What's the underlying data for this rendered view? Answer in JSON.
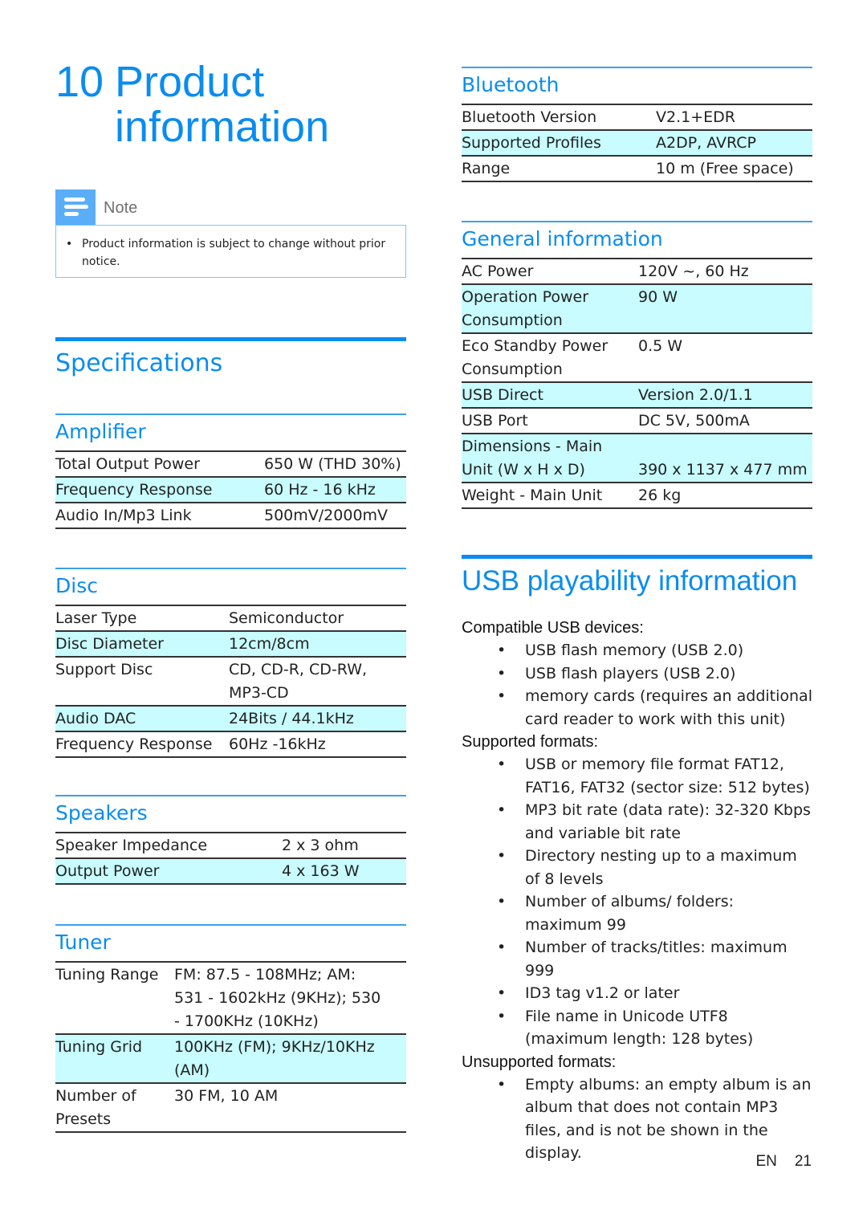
{
  "chapter": {
    "number": "10",
    "title_line1": "Product",
    "title_line2": "information"
  },
  "note": {
    "icon": "note-icon",
    "label": "Note",
    "items": [
      "Product information is subject to change without prior notice."
    ]
  },
  "specifications": {
    "title": "Specifications"
  },
  "amplifier": {
    "title": "Amplifier",
    "rows": [
      {
        "label": "Total Output Power",
        "value": "650 W  (THD 30%)"
      },
      {
        "label": "Frequency Response",
        "value": "60 Hz - 16 kHz"
      },
      {
        "label": "Audio In/Mp3 Link",
        "value": "500mV/2000mV"
      }
    ]
  },
  "disc": {
    "title": "Disc",
    "rows": [
      {
        "label": "Laser Type",
        "value": "Semiconductor"
      },
      {
        "label": "Disc Diameter",
        "value": "12cm/8cm"
      },
      {
        "label": "Support Disc",
        "value": "CD, CD-R, CD-RW, MP3-CD"
      },
      {
        "label": "Audio DAC",
        "value": "24Bits / 44.1kHz"
      },
      {
        "label": "Frequency Response",
        "value": "60Hz -16kHz"
      }
    ]
  },
  "speakers": {
    "title": "Speakers",
    "rows": [
      {
        "label": "Speaker Impedance",
        "value": "2 x 3 ohm"
      },
      {
        "label": "Output Power",
        "value": "4 x 163 W"
      }
    ]
  },
  "tuner": {
    "title": "Tuner",
    "rows": [
      {
        "label": "Tuning Range",
        "value": "FM: 87.5 - 108MHz; AM: 531 - 1602kHz (9KHz); 530 - 1700KHz (10KHz)"
      },
      {
        "label": "Tuning Grid",
        "value": "100KHz (FM); 9KHz/10KHz (AM)"
      },
      {
        "label": "Number of Presets",
        "value": "30 FM, 10 AM"
      }
    ]
  },
  "bluetooth": {
    "title": "Bluetooth",
    "rows": [
      {
        "label": "Bluetooth Version",
        "value": "V2.1+EDR"
      },
      {
        "label": "Supported Profiles",
        "value": "A2DP, AVRCP"
      },
      {
        "label": "Range",
        "value": "10 m (Free space)"
      }
    ]
  },
  "general": {
    "title": "General information",
    "rows": [
      {
        "label": "AC Power",
        "value": "120V ~, 60 Hz"
      },
      {
        "label": "Operation Power Consumption",
        "value": "90 W"
      },
      {
        "label": "Eco Standby Power Consumption",
        "value": "0.5 W"
      },
      {
        "label": "USB Direct",
        "value": "Version 2.0/1.1"
      },
      {
        "label": "USB Port",
        "value": "DC 5V, 500mA"
      },
      {
        "label": "Dimensions - Main Unit (W x H x D)",
        "value": "390 x 1137 x 477 mm"
      },
      {
        "label": "Weight - Main Unit",
        "value": "26 kg"
      }
    ]
  },
  "usb": {
    "title": "USB playability information",
    "compatible": {
      "heading": "Compatible USB devices:",
      "items": [
        "USB flash memory (USB 2.0)",
        "USB flash players (USB 2.0)",
        "memory cards (requires an additional card reader to work with this unit)"
      ]
    },
    "supported": {
      "heading": "Supported formats:",
      "items": [
        "USB or memory file format FAT12, FAT16, FAT32 (sector size: 512 bytes)",
        "MP3 bit rate (data rate): 32-320 Kbps and variable bit rate",
        "Directory nesting up to a maximum of 8 levels",
        "Number of albums/ folders: maximum 99",
        "Number of tracks/titles: maximum 999",
        "ID3 tag v1.2 or later",
        "File name in Unicode UTF8 (maximum length: 128 bytes)"
      ]
    },
    "unsupported": {
      "heading": "Unsupported formats:",
      "items": [
        "Empty albums: an empty album is an album that does not contain MP3 files, and is not be shown in the display."
      ]
    }
  },
  "footer": {
    "lang": "EN",
    "page": "21"
  },
  "colors": {
    "accent": "#0a8cf0",
    "row_highlight": "#c8fcff",
    "note_icon": "#5aaef8"
  }
}
